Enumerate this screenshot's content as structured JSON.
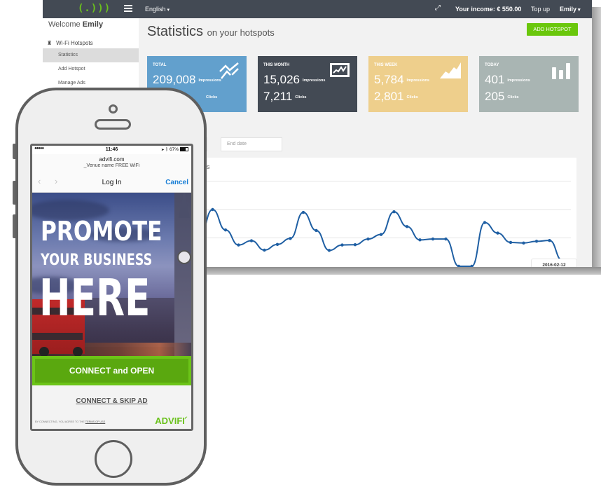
{
  "topbar": {
    "logo": "(.)))",
    "language": "English",
    "income_label": "Your income:",
    "income_value": "€ 550.00",
    "top_up": "Top up",
    "user": "Emily",
    "expand_icon": "expand-icon"
  },
  "sidebar": {
    "welcome_prefix": "Welcome",
    "welcome_name": "Emily",
    "section": "Wi-Fi Hotspots",
    "items": [
      {
        "label": "Statistics",
        "active": true
      },
      {
        "label": "Add Hotspot",
        "active": false
      },
      {
        "label": "Manage Ads",
        "active": false
      }
    ]
  },
  "main": {
    "title": "Statistics",
    "subtitle": "on your hotspots",
    "add_button": "ADD HOTSPOT",
    "cards": [
      {
        "label": "TOTAL",
        "impressions": "209,008",
        "clicks": "",
        "impressions_unit": "Impressions",
        "clicks_unit": "Clicks",
        "color": "#62a0cd",
        "icon": "trend-lines-icon"
      },
      {
        "label": "THIS MONTH",
        "impressions": "15,026",
        "clicks": "7,211",
        "impressions_unit": "Impressions",
        "clicks_unit": "Clicks",
        "color": "#434a54",
        "icon": "line-chart-box-icon"
      },
      {
        "label": "THIS WEEK",
        "impressions": "5,784",
        "clicks": "2,801",
        "impressions_unit": "Impressions",
        "clicks_unit": "Clicks",
        "color": "#eecf8c",
        "icon": "area-chart-icon"
      },
      {
        "label": "TODAY",
        "impressions": "401",
        "clicks": "205",
        "impressions_unit": "Impressions",
        "clicks_unit": "Clicks",
        "color": "#a9b5b3",
        "icon": "bar-chart-icon"
      }
    ],
    "end_date_placeholder": "End date",
    "chart_title_fragment": "ons",
    "tooltip_date": "2016-02-12"
  },
  "chart_data": {
    "type": "line",
    "title": "…ons",
    "xlabel": "",
    "ylabel": "",
    "grid": true,
    "legend": "none",
    "series": [
      {
        "name": "Impressions",
        "color": "#1f5fa3",
        "values": [
          1.05,
          2.0,
          1.28,
          0.75,
          0.9,
          0.57,
          0.77,
          0.98,
          1.9,
          1.26,
          0.56,
          0.75,
          0.76,
          0.96,
          1.12,
          1.92,
          1.4,
          0.93,
          0.96,
          0.96,
          0.0,
          0.0,
          1.54,
          1.17,
          0.84,
          0.82,
          0.88,
          0.91,
          0.2
        ]
      }
    ],
    "gridlines": [
      1,
      2,
      3
    ],
    "ylim": [
      0,
      3
    ]
  },
  "phone": {
    "status": {
      "signal": "●●●●●",
      "time": "11:46",
      "battery": "67%"
    },
    "domain": "advifi.com",
    "venue": "_Venue name FREE WiFi",
    "back": "‹",
    "forward": "›",
    "page_title": "Log In",
    "cancel": "Cancel",
    "ad_line1": "PROMOTE",
    "ad_line2": "YOUR BUSINESS",
    "ad_line3": "HERE",
    "connect_open": "CONNECT and OPEN",
    "connect_skip": "CONNECT & SKIP AD",
    "terms_prefix": "BY CONNECTING, YOU AGREE TO THE",
    "terms_link": "TERMS OF USE",
    "brand": "ADVIFI"
  }
}
